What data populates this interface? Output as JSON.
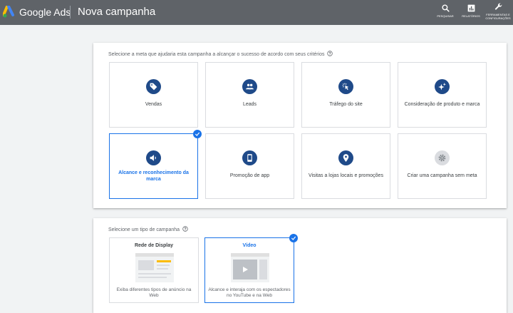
{
  "header": {
    "brand": "Google Ads",
    "title": "Nova campanha",
    "tools": [
      {
        "label": "PESQUISAR",
        "icon": "search-icon"
      },
      {
        "label": "RELATÓRIOS",
        "icon": "reports-icon"
      },
      {
        "label": "FERRAMENTAS E CONFIGURAÇÕES",
        "icon": "wrench-icon"
      }
    ]
  },
  "goals": {
    "prompt": "Selecione a meta que ajudaria esta campanha a alcançar o sucesso de acordo com seus critérios",
    "items": [
      {
        "label": "Vendas",
        "icon": "tag-icon",
        "selected": false
      },
      {
        "label": "Leads",
        "icon": "people-icon",
        "selected": false
      },
      {
        "label": "Tráfego do site",
        "icon": "cursor-click-icon",
        "selected": false
      },
      {
        "label": "Consideração de produto e marca",
        "icon": "sparkle-icon",
        "selected": false
      },
      {
        "label": "Alcance e reconhecimento da marca",
        "icon": "speaker-icon",
        "selected": true
      },
      {
        "label": "Promoção de app",
        "icon": "phone-icon",
        "selected": false
      },
      {
        "label": "Visitas a lojas locais e promoções",
        "icon": "location-pin-icon",
        "selected": false
      },
      {
        "label": "Criar uma campanha sem meta",
        "icon": "gear-icon",
        "selected": false
      }
    ]
  },
  "campaign_types": {
    "prompt": "Selecione um tipo de campanha",
    "items": [
      {
        "title": "Rede de Display",
        "description": "Exiba diferentes tipos de anúncio na Web",
        "selected": false
      },
      {
        "title": "Vídeo",
        "description": "Alcance e interaja com os espectadores no YouTube e na Web",
        "selected": true
      }
    ]
  },
  "colors": {
    "topbar": "#5f6368",
    "icon_circle": "#1f4a89",
    "selected_accent": "#1a73e8"
  }
}
